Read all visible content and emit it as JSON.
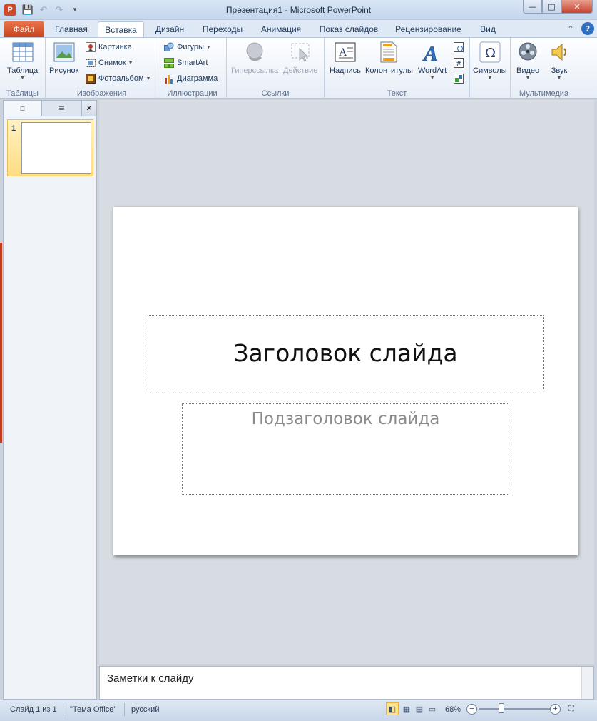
{
  "window": {
    "title": "Презентация1 - Microsoft PowerPoint",
    "app_icon": "P",
    "controls": {
      "minimize": "—",
      "maximize": "□",
      "close": "✕"
    }
  },
  "qat": {
    "save_icon": "💾",
    "undo_icon": "↶",
    "redo_icon": "↷",
    "customize_icon": "▾"
  },
  "tabs": [
    {
      "label": "Файл"
    },
    {
      "label": "Главная"
    },
    {
      "label": "Вставка"
    },
    {
      "label": "Дизайн"
    },
    {
      "label": "Переходы"
    },
    {
      "label": "Анимация"
    },
    {
      "label": "Показ слайдов"
    },
    {
      "label": "Рецензирование"
    },
    {
      "label": "Вид"
    }
  ],
  "active_tab": "Вставка",
  "ribbon": {
    "groups": {
      "tables": "Таблицы",
      "images": "Изображения",
      "illustrations": "Иллюстрации",
      "links": "Ссылки",
      "text": "Текст",
      "media": "Мультимедиа"
    },
    "buttons": {
      "table": "Таблица",
      "picture": "Рисунок",
      "clipart": "Картинка",
      "screenshot": "Снимок",
      "photoalbum": "Фотоальбом",
      "shapes": "Фигуры",
      "smartart": "SmartArt",
      "chart": "Диаграмма",
      "hyperlink": "Гиперссылка",
      "action": "Действие",
      "textbox": "Надпись",
      "headerfooter": "Колонтитулы",
      "wordart": "WordArt",
      "symbols": "Символы",
      "video": "Видео",
      "audio": "Звук"
    }
  },
  "slides_pane": {
    "slide_number": "1"
  },
  "slide": {
    "title_placeholder": "Заголовок слайда",
    "subtitle_placeholder": "Подзаголовок слайда"
  },
  "notes": {
    "placeholder": "Заметки к слайду"
  },
  "status": {
    "slide_info": "Слайд 1 из 1",
    "theme": "\"Тема Office\"",
    "language": "русский",
    "zoom": "68%",
    "zoom_level": 0.68
  },
  "colors": {
    "file_tab": "#c9431e",
    "accent": "#2f6fc1",
    "selected_view": "#fde38a"
  }
}
